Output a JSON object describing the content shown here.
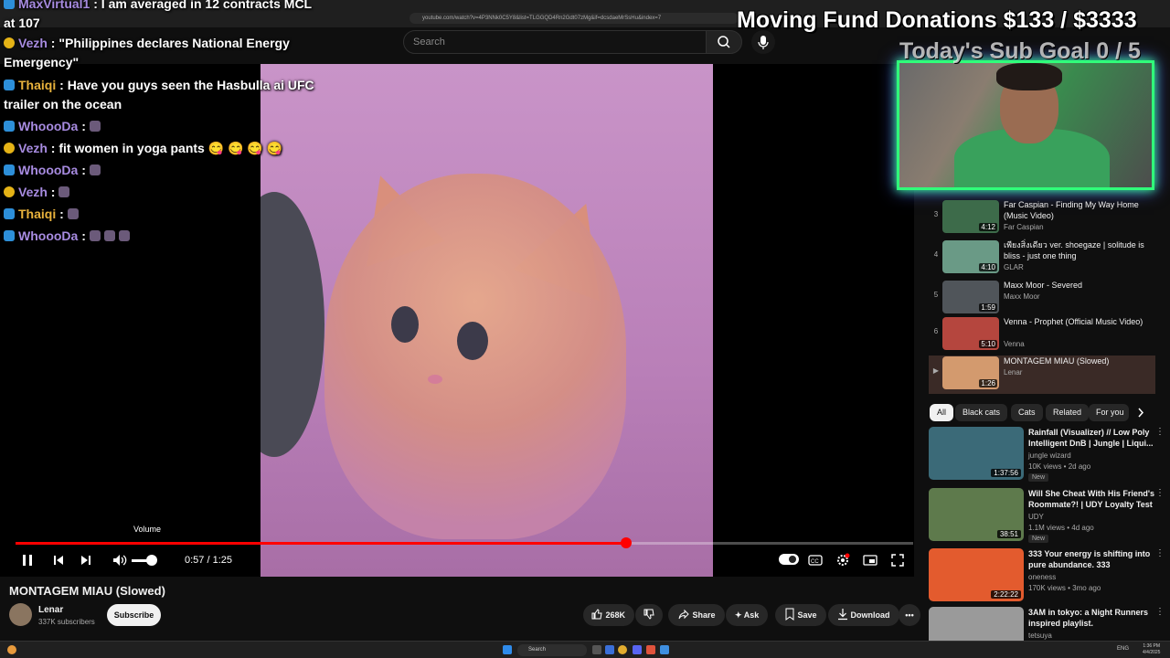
{
  "browser": {
    "url": "youtube.com/watch?v=4P3NNk0C5Y8&list=TLGGQD4Rn2Gdt07zMg&if=dcsdaeMrSsHu&index=7"
  },
  "header": {
    "search_placeholder": "Search"
  },
  "overlay": {
    "donations": "Moving Fund Donations $133 / $3333",
    "sub_goal": "Today's Sub Goal 0 / 5"
  },
  "chat": [
    {
      "user": "MaxVirtual1",
      "badge": "blue",
      "text": "I am averaged in 12 contracts MCL at 107",
      "name_color": "#a78be0"
    },
    {
      "user": "Vezh",
      "badge": "gold",
      "text": "\"Philippines declares National Energy Emergency\"",
      "name_color": "#a78be0"
    },
    {
      "user": "Thaiqi",
      "badge": "blue",
      "text": "Have you guys seen the Hasbulla ai UFC trailer on the ocean",
      "name_color": "#e8b23c"
    },
    {
      "user": "WhoooDa",
      "badge": "blue",
      "text": "",
      "name_color": "#a78be0"
    },
    {
      "user": "Vezh",
      "badge": "gold",
      "text": "fit women in yoga pants 😋 😋 😋 😋",
      "name_color": "#a78be0"
    },
    {
      "user": "WhoooDa",
      "badge": "blue",
      "text": "",
      "name_color": "#a78be0"
    },
    {
      "user": "Vezh",
      "badge": "gold",
      "text": "",
      "name_color": "#a78be0"
    },
    {
      "user": "Thaiqi",
      "badge": "blue",
      "text": "",
      "name_color": "#e8b23c"
    },
    {
      "user": "WhoooDa",
      "badge": "blue",
      "text": "",
      "name_color": "#a78be0"
    }
  ],
  "player": {
    "volume_tooltip": "Volume",
    "current_time": "0:57",
    "duration": "1:25",
    "time_display": "0:57 / 1:25",
    "progress": 0.68
  },
  "video": {
    "title": "MONTAGEM MIAU (Slowed)",
    "channel": "Lenar",
    "subscribers": "337K subscribers",
    "subscribe_label": "Subscribe",
    "likes": "268K",
    "share_label": "Share",
    "ask_label": "Ask",
    "save_label": "Save",
    "download_label": "Download"
  },
  "playlist": [
    {
      "index": "3",
      "title": "Far Caspian - Finding My Way Home (Music Video)",
      "channel": "Far Caspian",
      "duration": "4:12",
      "thumb": "#3d6b4a",
      "active": false
    },
    {
      "index": "4",
      "title": "เพียงสิ่งเดียว ver. shoegaze | solitude is bliss - just one thing",
      "channel": "GLAR",
      "duration": "4:10",
      "thumb": "#6a9a86",
      "active": false
    },
    {
      "index": "5",
      "title": "Maxx Moor - Severed",
      "channel": "Maxx Moor",
      "duration": "1:59",
      "thumb": "#50555a",
      "active": false
    },
    {
      "index": "6",
      "title": "Venna - Prophet (Official Music Video)",
      "channel": "Venna",
      "duration": "5:10",
      "thumb": "#b5463e",
      "active": false
    },
    {
      "index": "▶",
      "title": "MONTAGEM MIAU (Slowed)",
      "channel": "Lenar",
      "duration": "1:26",
      "thumb": "#d39a6e",
      "active": true
    }
  ],
  "chips": [
    {
      "label": "All",
      "active": true
    },
    {
      "label": "Black cats",
      "active": false
    },
    {
      "label": "Cats",
      "active": false
    },
    {
      "label": "Related",
      "active": false
    },
    {
      "label": "For you",
      "active": false
    }
  ],
  "recommendations": [
    {
      "title": "Rainfall (Visualizer) // Low Poly Intelligent DnB | Jungle | Liqui...",
      "channel": "jungle wizard",
      "stats": "10K views • 2d ago",
      "new": "New",
      "duration": "1:37:56",
      "thumb": "#3b6a78"
    },
    {
      "title": "Will She Cheat With His Friend's Roommate?! | UDY Loyalty Test",
      "channel": "UDY",
      "stats": "1.1M views • 4d ago",
      "new": "New",
      "duration": "38:51",
      "thumb": "#5e7a4c"
    },
    {
      "title": "333 Your energy is shifting into pure abundance. 333",
      "channel": "oneness",
      "stats": "170K views • 3mo ago",
      "new": "",
      "duration": "2:22:22",
      "thumb": "#e35b2e"
    },
    {
      "title": "3AM in tokyo: a Night Runners inspired playlist.",
      "channel": "tetsuya",
      "stats": "",
      "new": "",
      "duration": "",
      "thumb": "#9a9a9a"
    }
  ],
  "taskbar": {
    "search_label": "Search",
    "time": "1:36 PM",
    "date": "4/4/2025",
    "lang": "ENG"
  }
}
